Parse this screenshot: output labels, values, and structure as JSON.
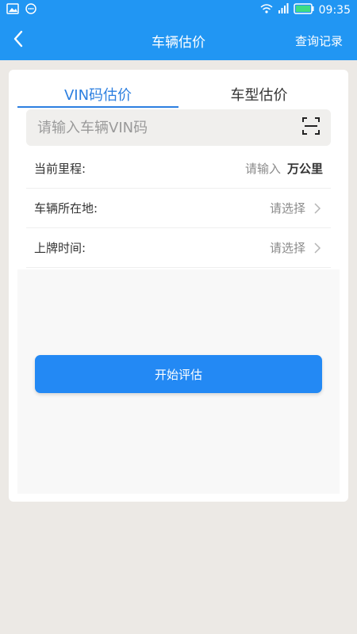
{
  "status_bar": {
    "time": "09:35",
    "battery_level": 1.0
  },
  "header": {
    "title": "车辆估价",
    "history_link": "查询记录"
  },
  "tabs": [
    {
      "label": "VIN码估价",
      "active": true
    },
    {
      "label": "车型估价",
      "active": false
    }
  ],
  "vin": {
    "placeholder": "请输入车辆VIN码",
    "value": ""
  },
  "form": {
    "mileage": {
      "label": "当前里程:",
      "placeholder": "请输入",
      "unit": "万公里"
    },
    "location": {
      "label": "车辆所在地:",
      "value": "请选择"
    },
    "plate_date": {
      "label": "上牌时间:",
      "value": "请选择"
    }
  },
  "actions": {
    "start_label": "开始评估"
  },
  "colors": {
    "primary": "#2196f3",
    "button": "#2389f4",
    "tab_active": "#2c7fe0",
    "background": "#ece9e5"
  },
  "icons": {
    "back": "chevron-left-icon",
    "scan": "scan-icon",
    "row_arrow": "chevron-right-icon"
  }
}
